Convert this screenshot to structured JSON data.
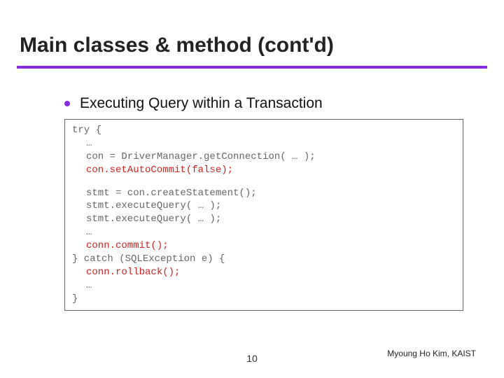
{
  "title": "Main classes & method (cont'd)",
  "bullet": "Executing Query within a Transaction",
  "code": {
    "l1": "try {",
    "l2": "…",
    "l3": "con = DriverManager.getConnection( … );",
    "l4": "con.setAutoCommit(false);",
    "l5": "stmt = con.createStatement();",
    "l6": "stmt.executeQuery( … );",
    "l7": "stmt.executeQuery( … );",
    "l8": "…",
    "l9": "conn.commit();",
    "l10": "} catch (SQLException e) {",
    "l11": "conn.rollback();",
    "l12": "…",
    "l13": "}"
  },
  "page_number": "10",
  "footer": "Myoung Ho Kim, KAIST"
}
